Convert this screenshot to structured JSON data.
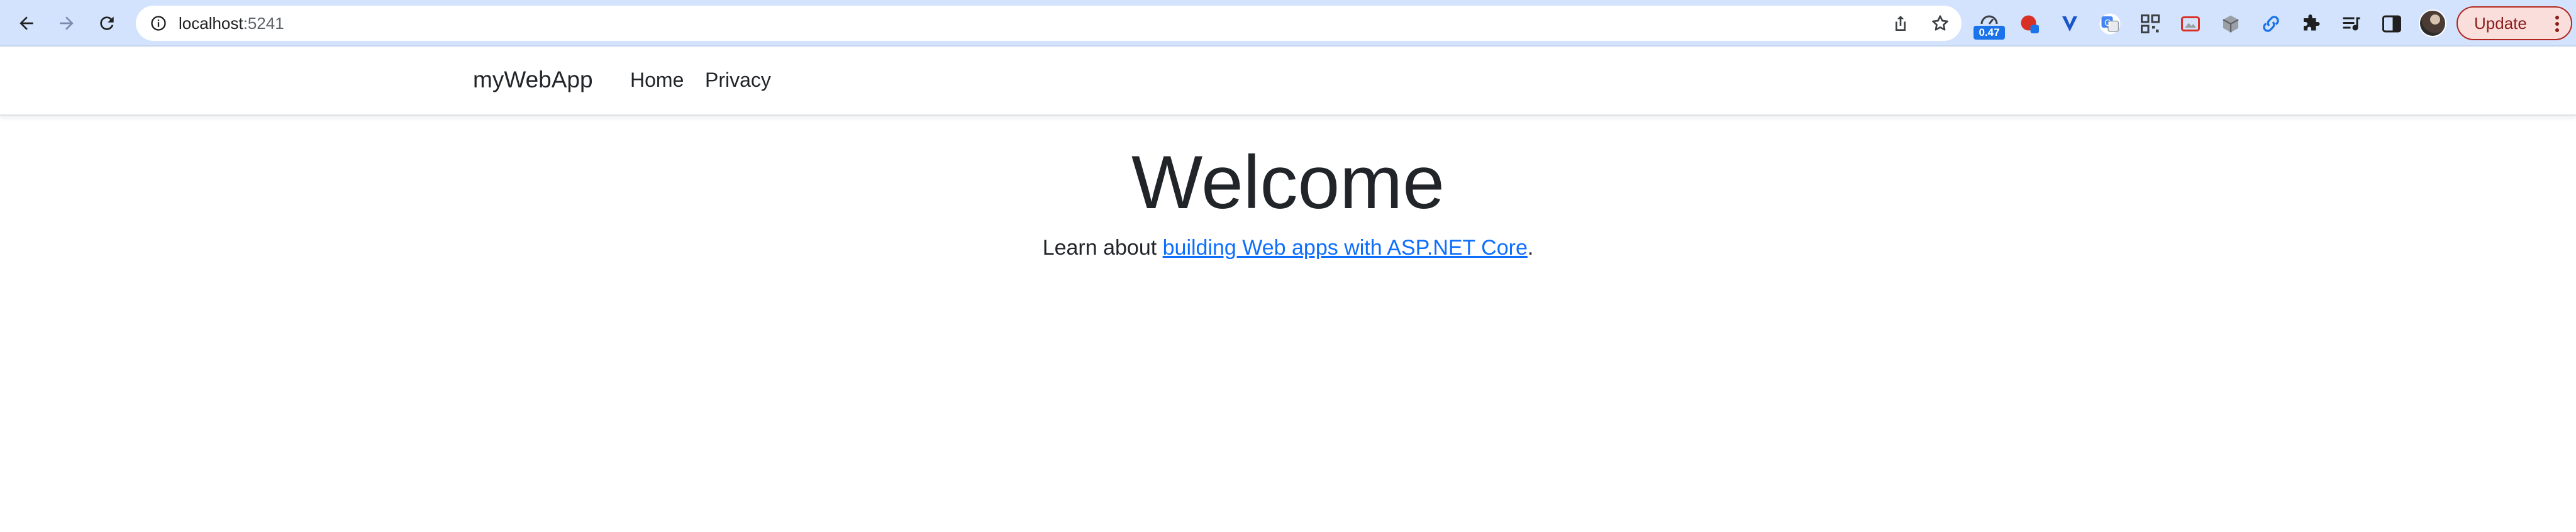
{
  "browser": {
    "url_host": "localhost",
    "url_port": ":5241",
    "extension_badge": "0.47",
    "update_label": "Update"
  },
  "icons": {
    "back": "back-arrow-icon",
    "forward": "forward-arrow-icon",
    "reload": "reload-icon",
    "info": "info-icon",
    "share": "share-icon",
    "bookmark": "star-icon",
    "menu": "kebab-menu-icon"
  },
  "site": {
    "brand": "myWebApp",
    "nav": [
      {
        "label": "Home"
      },
      {
        "label": "Privacy"
      }
    ],
    "heading": "Welcome",
    "learn_prefix": "Learn about ",
    "learn_link": "building Web apps with ASP.NET Core",
    "learn_suffix": "."
  },
  "colors": {
    "toolbar": "#d3e3fd",
    "link": "#0d6efd",
    "text": "#212529",
    "update_border": "#b3261e"
  }
}
